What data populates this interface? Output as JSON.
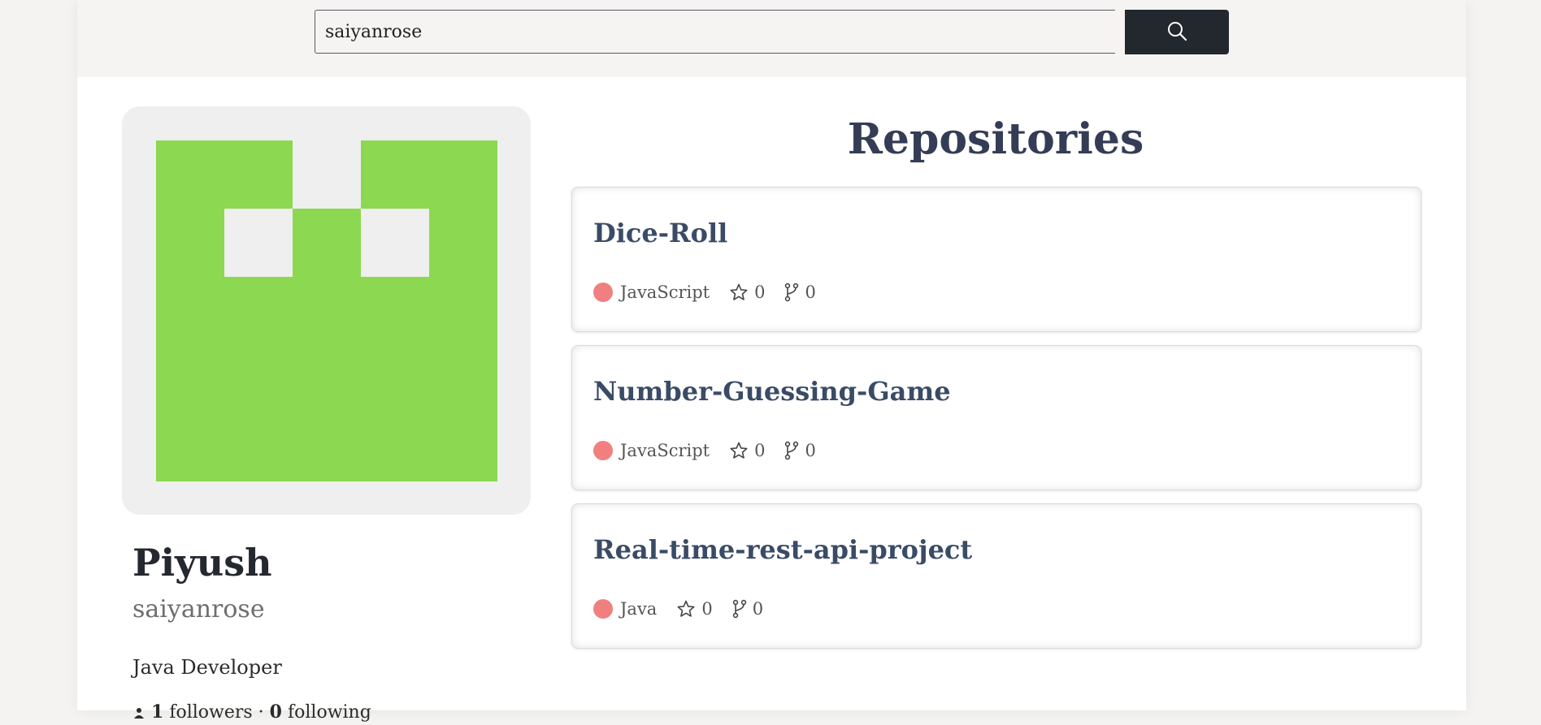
{
  "search": {
    "value": "saiyanrose",
    "button_icon": "search-icon"
  },
  "profile": {
    "avatar_colors": {
      "foreground": "#8cd850",
      "background": "#efefef"
    },
    "name": "Piyush",
    "login": "saiyanrose",
    "bio": "Java Developer",
    "followers_count": "1",
    "followers_label": "followers",
    "following_count": "0",
    "following_label": "following"
  },
  "repositories": {
    "title": "Repositories",
    "items": [
      {
        "name": "Dice-Roll",
        "language": "JavaScript",
        "language_color": "#f08080",
        "stars": "0",
        "forks": "0"
      },
      {
        "name": "Number-Guessing-Game",
        "language": "JavaScript",
        "language_color": "#f08080",
        "stars": "0",
        "forks": "0"
      },
      {
        "name": "Real-time-rest-api-project",
        "language": "Java",
        "language_color": "#f08080",
        "stars": "0",
        "forks": "0"
      }
    ]
  }
}
